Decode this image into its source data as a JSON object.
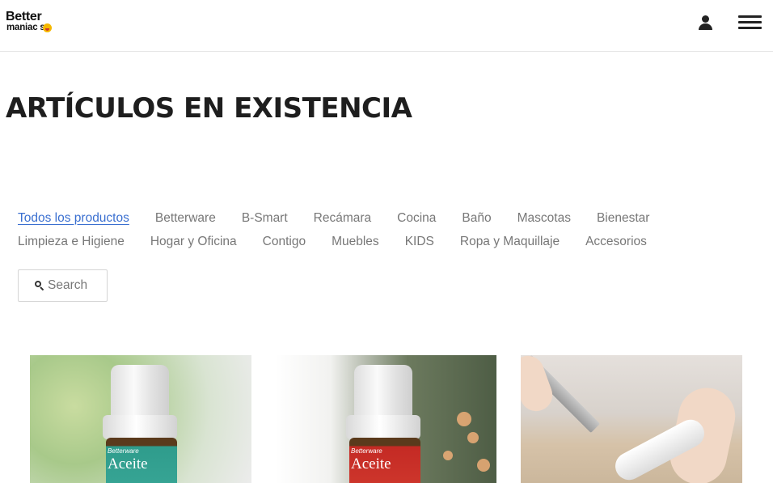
{
  "header": {
    "logo_line1": "Better",
    "logo_line2": "maniac s",
    "user_icon": "user-icon",
    "menu_icon": "hamburger-menu-icon"
  },
  "page": {
    "title": "ARTÍCULOS EN EXISTENCIA"
  },
  "categories": {
    "row1": [
      "Todos los productos",
      "Betterware",
      "B-Smart",
      "Recámara",
      "Cocina",
      "Baño",
      "Mascotas",
      "Bienestar"
    ],
    "row2": [
      "Limpieza e Higiene",
      "Hogar y Oficina",
      "Contigo",
      "Muebles",
      "KIDS",
      "Ropa y Maquillaje",
      "Accesorios"
    ],
    "active": "Todos los productos"
  },
  "search": {
    "placeholder": "Search",
    "icon": "search-icon"
  },
  "products": [
    {
      "brand": "Betterware",
      "label": "Aceite",
      "image": "teal-essential-oil-bottle"
    },
    {
      "brand": "Betterware",
      "label": "Aceite",
      "image": "red-essential-oil-bottle"
    },
    {
      "image": "knife-sharpener-in-use"
    }
  ],
  "colors": {
    "active_link": "#3a6fd0",
    "category_text": "#777777",
    "title_text": "#1e1e1e"
  }
}
